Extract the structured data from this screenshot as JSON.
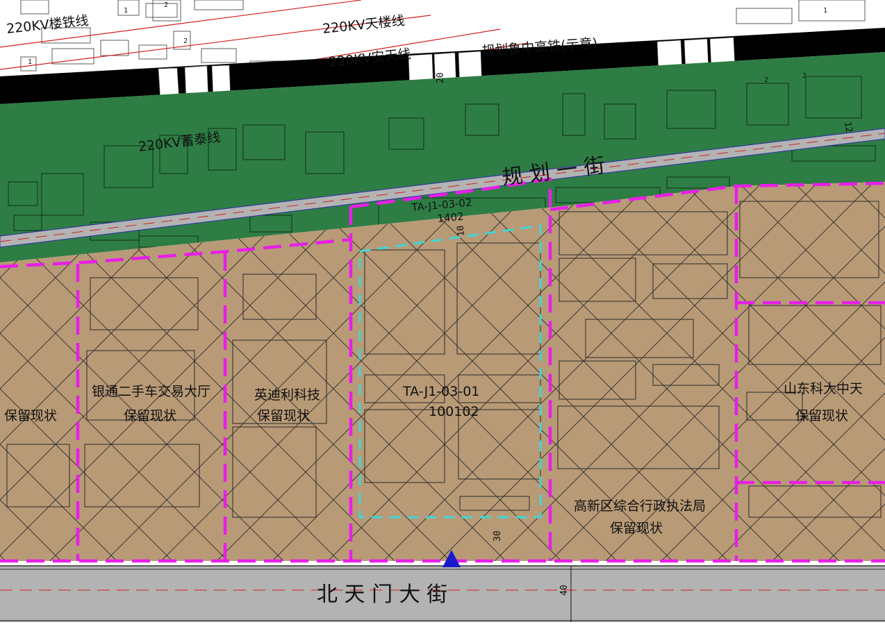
{
  "power_lines": {
    "lou_tie": "220KV楼铁线",
    "tian_lou": "220KV天楼线",
    "an_tian": "220KV安天线",
    "xu_tai": "220KV蓄泰线"
  },
  "railway": {
    "label": "规划鲁中高铁(示意)",
    "width_label": "20"
  },
  "roads": {
    "north": {
      "label": "规  划  一  街",
      "width_label": "12"
    },
    "south": {
      "label": "北  天  门  大  街",
      "width_label": "40"
    }
  },
  "parcels": {
    "main": {
      "code": "TA-J1-03-01",
      "number": "100102"
    },
    "north_strip": {
      "code": "TA-J1-03-02",
      "number": "1402",
      "setback_label": "10"
    },
    "setback_south": "30",
    "yintong": {
      "name": "银通二手车交易大厅",
      "status": "保留现状"
    },
    "west_edge": {
      "status": "保留现状"
    },
    "yingdili": {
      "name": "英迪利科技",
      "status": "保留现状"
    },
    "gaoxin": {
      "name": "高新区综合行政执法局",
      "status": "保留现状"
    },
    "shandong": {
      "name": "山东科大中天",
      "status": "保留现状"
    }
  },
  "building_numbers": [
    "1",
    "2",
    "1",
    "2",
    "1",
    "2",
    "2"
  ],
  "colors": {
    "green_belt": "#2e7d44",
    "parcel_fill": "#b89a76",
    "road": "#b3b3b3",
    "boundary": "#e81ee8",
    "site_line": "#3fd7d7",
    "rail": "#000000",
    "red_line": "#d22020",
    "north_arrow": "#1a1acc"
  }
}
